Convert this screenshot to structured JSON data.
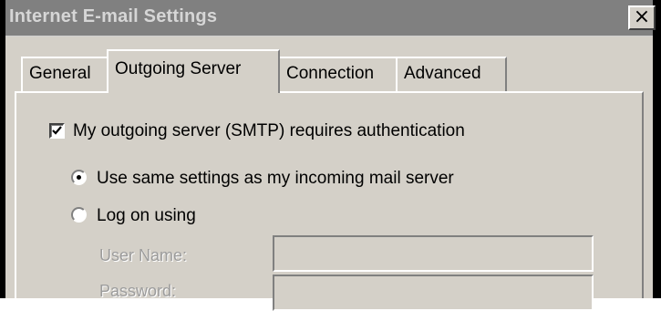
{
  "window": {
    "title": "Internet E-mail Settings",
    "close_glyph": "×",
    "title_bar_color": "#808080",
    "face_color": "#d4d0c8"
  },
  "tabs": [
    {
      "label": "General",
      "active": false
    },
    {
      "label": "Outgoing Server",
      "active": true
    },
    {
      "label": "Connection",
      "active": false
    },
    {
      "label": "Advanced",
      "active": false
    }
  ],
  "outgoing": {
    "auth_checkbox_label": "My outgoing server (SMTP) requires authentication",
    "auth_checked": true,
    "radio_same_label": "Use same settings as my incoming mail server",
    "radio_same_selected": true,
    "radio_logon_label": "Log on using",
    "radio_logon_selected": false,
    "user_name_label": "User Name:",
    "user_name_value": "",
    "password_label": "Password:",
    "password_value": ""
  }
}
